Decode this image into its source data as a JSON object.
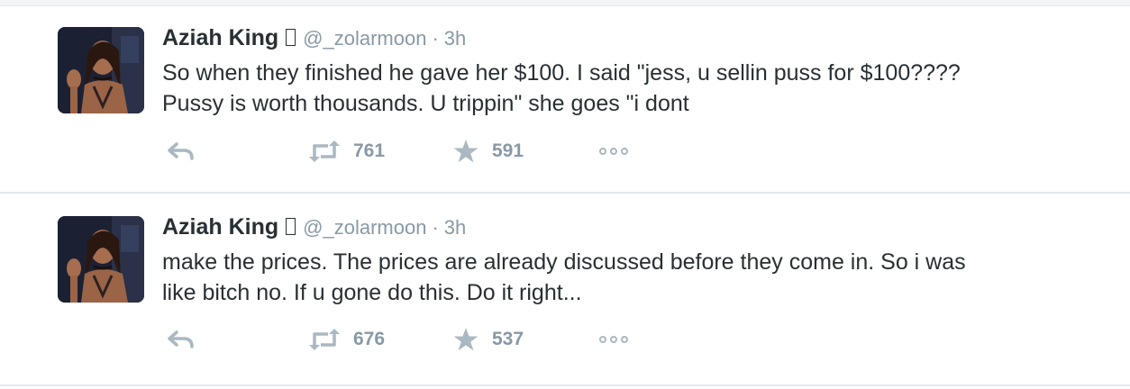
{
  "colors": {
    "text": "#292f33",
    "muted": "#8899a6",
    "icon": "#aab8c2",
    "divider": "#e1e8ed"
  },
  "tweets": [
    {
      "fullname": "Aziah King",
      "emoji_placeholder": "▯",
      "username": "@_zolarmoon",
      "separator": "·",
      "time": "3h",
      "text_lines": [
        "So when they finished he gave her $100. I said \"jess, u sellin puss for $100????",
        "Pussy is worth thousands. U trippin\" she goes \"i dont"
      ],
      "retweets": "761",
      "favorites": "591",
      "icons": [
        "reply-icon",
        "retweet-icon",
        "star-icon",
        "more-dots-icon"
      ]
    },
    {
      "fullname": "Aziah King",
      "emoji_placeholder": "▯",
      "username": "@_zolarmoon",
      "separator": "·",
      "time": "3h",
      "text_lines": [
        "make the prices. The prices are already discussed before they come in. So i was",
        "like bitch no. If u gone do this. Do it right..."
      ],
      "retweets": "676",
      "favorites": "537",
      "icons": [
        "reply-icon",
        "retweet-icon",
        "star-icon",
        "more-dots-icon"
      ]
    }
  ]
}
